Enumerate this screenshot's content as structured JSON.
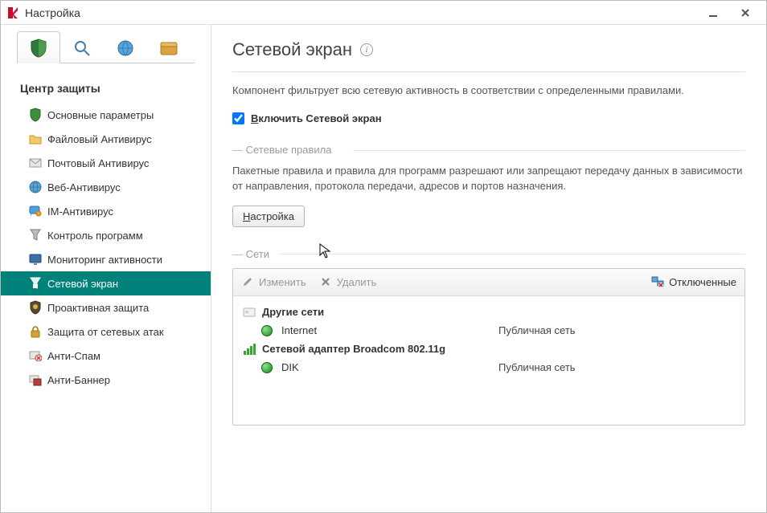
{
  "window": {
    "title": "Настройка"
  },
  "sidebar": {
    "section_title": "Центр защиты",
    "items": [
      {
        "label": "Основные параметры",
        "icon": "shield-green-icon"
      },
      {
        "label": "Файловый Антивирус",
        "icon": "folder-icon"
      },
      {
        "label": "Почтовый Антивирус",
        "icon": "mail-icon"
      },
      {
        "label": "Веб-Антивирус",
        "icon": "web-globe-icon"
      },
      {
        "label": "IM-Антивирус",
        "icon": "chat-icon"
      },
      {
        "label": "Контроль программ",
        "icon": "funnel-icon"
      },
      {
        "label": "Мониторинг активности",
        "icon": "monitor-icon"
      },
      {
        "label": "Сетевой экран",
        "icon": "firewall-icon"
      },
      {
        "label": "Проактивная защита",
        "icon": "proactive-shield-icon"
      },
      {
        "label": "Защита от сетевых атак",
        "icon": "lock-icon"
      },
      {
        "label": "Анти-Спам",
        "icon": "antispam-icon"
      },
      {
        "label": "Анти-Баннер",
        "icon": "antibanner-icon"
      }
    ],
    "active_index": 7
  },
  "main": {
    "title": "Сетевой экран",
    "description": "Компонент фильтрует всю сетевую активность в соответствии с определенными правилами.",
    "enable_checkbox": {
      "checked": true,
      "label_prefix_ul": "В",
      "label_rest": "ключить Сетевой экран"
    },
    "rules_section": {
      "legend": "Сетевые правила",
      "description": "Пакетные правила и правила для программ разрешают или запрещают передачу данных в зависимости от направления, протокола передачи, адресов и портов назначения.",
      "button_prefix_ul": "Н",
      "button_rest": "астройка"
    },
    "networks_section": {
      "legend": "Сети",
      "toolbar": {
        "edit": "Изменить",
        "delete": "Удалить",
        "disconnected": "Отключенные"
      },
      "groups": [
        {
          "title": "Другие сети",
          "icon": "card-icon",
          "items": [
            {
              "name": "Internet",
              "type": "Публичная сеть",
              "icon": "globe-icon"
            }
          ]
        },
        {
          "title": "Сетевой адаптер Broadcom 802.11g",
          "icon": "signal-bars-icon",
          "items": [
            {
              "name": "DIK",
              "type": "Публичная сеть",
              "icon": "globe-icon"
            }
          ]
        }
      ]
    }
  }
}
